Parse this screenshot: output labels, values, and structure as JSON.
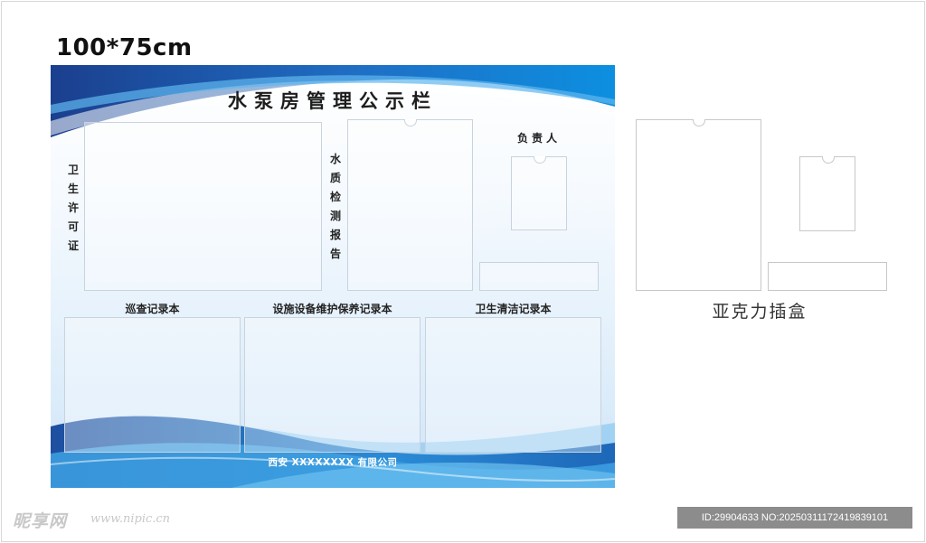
{
  "size_label": "100*75cm",
  "board": {
    "title": "水泵房管理公示栏",
    "sanitation_permit_label": "卫生许可证",
    "water_quality_label": "水质检测报告",
    "responsible_person_label": "负责人",
    "inspection_record_label": "巡查记录本",
    "facility_maintenance_label": "设施设备维护保养记录本",
    "cleaning_record_label": "卫生清洁记录本",
    "company_name": "西安 XXXXXXXX 有限公司"
  },
  "acrylic_box_label": "亚克力插盒",
  "watermark": {
    "logo_text": "昵享网",
    "url": "www.nipic.cn"
  },
  "image_id": "ID:29904633 NO:20250311172419839101",
  "colors": {
    "wave_dark": "#1a3f8f",
    "wave_mid": "#1f7fd0",
    "wave_light": "#5bb6ea",
    "panel_border": "#c9d3de"
  }
}
